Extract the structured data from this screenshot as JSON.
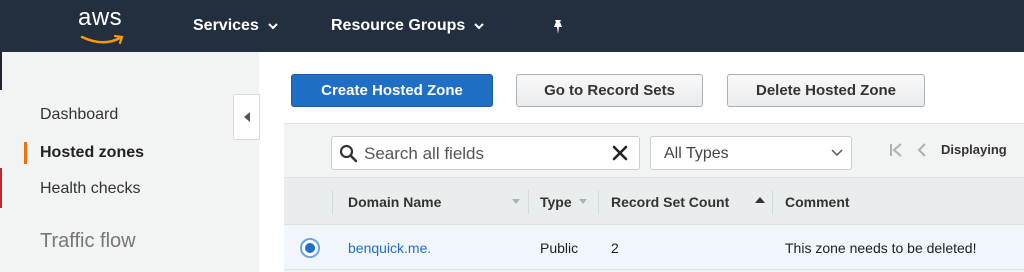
{
  "header": {
    "logo_text": "aws",
    "services_label": "Services",
    "resource_groups_label": "Resource Groups"
  },
  "sidebar": {
    "items": [
      {
        "label": "Dashboard"
      },
      {
        "label": "Hosted zones",
        "active": true
      },
      {
        "label": "Health checks"
      },
      {
        "label": "Traffic flow"
      }
    ]
  },
  "toolbar": {
    "create_label": "Create Hosted Zone",
    "goto_label": "Go to Record Sets",
    "delete_label": "Delete Hosted Zone"
  },
  "filter": {
    "search_placeholder": "Search all fields",
    "type_selected": "All Types",
    "displaying_label": "Displaying"
  },
  "table": {
    "columns": [
      "Domain Name",
      "Type",
      "Record Set Count",
      "Comment"
    ],
    "rows": [
      {
        "domain": "benquick.me.",
        "type": "Public",
        "count": "2",
        "comment": "This zone needs to be deleted!",
        "selected": true
      }
    ]
  },
  "colors": {
    "nav_bg": "#232f3e",
    "primary": "#1f6fc6",
    "active_accent": "#ec7211"
  },
  "icons": [
    "pin-icon",
    "search-icon",
    "clear-icon",
    "chevron-down-icon",
    "first-page-icon",
    "prev-page-icon",
    "collapse-icon"
  ]
}
